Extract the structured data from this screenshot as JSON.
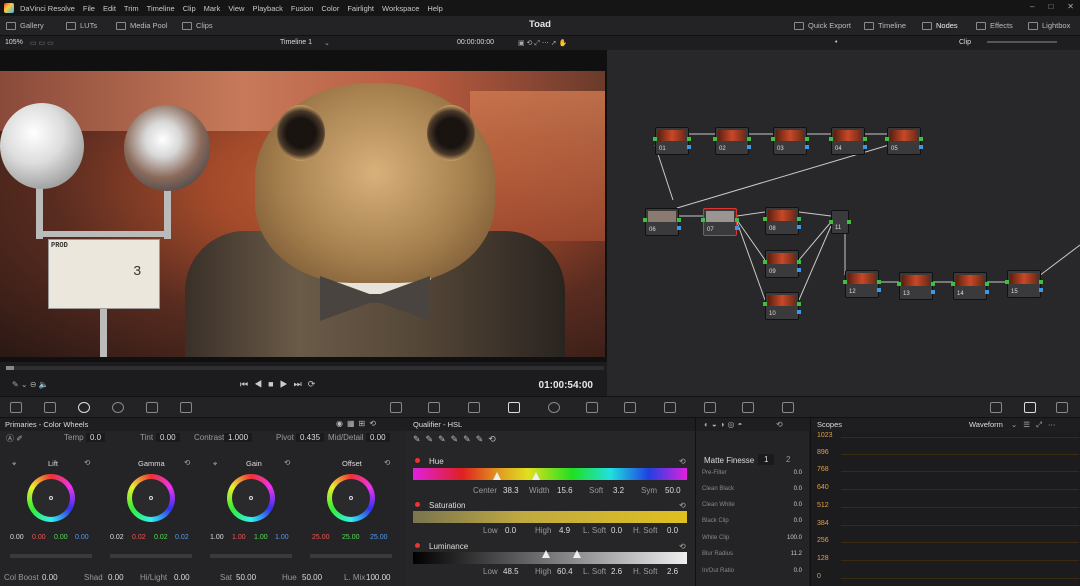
{
  "menubar": {
    "items": [
      "DaVinci Resolve",
      "File",
      "Edit",
      "Trim",
      "Timeline",
      "Clip",
      "Mark",
      "View",
      "Playback",
      "Fusion",
      "Color",
      "Fairlight",
      "Workspace",
      "Help"
    ]
  },
  "toolbar": {
    "gallery": "Gallery",
    "luts": "LUTs",
    "media_pool": "Media Pool",
    "clips": "Clips",
    "project": "Toad",
    "quick_export": "Quick Export",
    "timeline": "Timeline",
    "nodes": "Nodes",
    "effects": "Effects",
    "lightbox": "Lightbox"
  },
  "viewer": {
    "zoom": "105%",
    "timeline": "Timeline 1",
    "timecode_top": "00:00:00:00",
    "timecode": "01:00:54:00",
    "slate_text": "PROD",
    "slate_scene": "3"
  },
  "nodegraph": {
    "mode": "Clip",
    "nodes": [
      "01",
      "02",
      "03",
      "04",
      "05",
      "06",
      "07",
      "08",
      "09",
      "10",
      "11",
      "12",
      "13",
      "14",
      "15"
    ]
  },
  "primaries": {
    "title": "Primaries - Color Wheels",
    "temp_label": "Temp",
    "temp": "0.0",
    "tint_label": "Tint",
    "tint": "0.00",
    "contrast_label": "Contrast",
    "contrast": "1.000",
    "pivot_label": "Pivot",
    "pivot": "0.435",
    "middetail_label": "Mid/Detail",
    "middetail": "0.00",
    "wheels": [
      {
        "name": "Lift",
        "vals": [
          "0.00",
          "0.00",
          "0.00",
          "0.00"
        ]
      },
      {
        "name": "Gamma",
        "vals": [
          "0.02",
          "0.02",
          "0.02",
          "0.02"
        ]
      },
      {
        "name": "Gain",
        "vals": [
          "1.00",
          "1.00",
          "1.00",
          "1.00"
        ]
      },
      {
        "name": "Offset",
        "vals": [
          "25.00",
          "25.00",
          "25.00"
        ]
      }
    ],
    "colboost_label": "Col Boost",
    "colboost": "0.00",
    "shad_label": "Shad",
    "shad": "0.00",
    "hilight_label": "Hi/Light",
    "hilight": "0.00",
    "sat_label": "Sat",
    "sat": "50.00",
    "hue_label": "Hue",
    "hue": "50.00",
    "lmix_label": "L. Mix",
    "lmix": "100.00"
  },
  "qualifier": {
    "title": "Qualifier - HSL",
    "hue_label": "Hue",
    "center_label": "Center",
    "center": "38.3",
    "width_label": "Width",
    "width": "15.6",
    "soft_label": "Soft",
    "soft": "3.2",
    "sym_label": "Sym",
    "sym": "50.0",
    "sat_label": "Saturation",
    "low_label": "Low",
    "low": "0.0",
    "high_label": "High",
    "high": "4.9",
    "lsoft_label": "L. Soft",
    "lsoft": "0.0",
    "hsoft_label": "H. Soft",
    "hsoft": "0.0",
    "lum_label": "Luminance",
    "lum_low": "48.5",
    "lum_high": "60.4",
    "lum_lsoft": "2.6",
    "lum_hsoft": "2.6"
  },
  "matte": {
    "title": "Matte Finesse",
    "tab1": "1",
    "tab2": "2",
    "rows": [
      {
        "label": "Pre-Filter",
        "value": "0.0"
      },
      {
        "label": "Clean Black",
        "value": "0.0"
      },
      {
        "label": "Clean White",
        "value": "0.0"
      },
      {
        "label": "Black Clip",
        "value": "0.0"
      },
      {
        "label": "White Clip",
        "value": "100.0"
      },
      {
        "label": "Blur Radius",
        "value": "11.2"
      },
      {
        "label": "In/Out Ratio",
        "value": "0.0"
      }
    ]
  },
  "scopes": {
    "title": "Scopes",
    "mode": "Waveform",
    "ticks": [
      "1023",
      "896",
      "768",
      "640",
      "512",
      "384",
      "256",
      "128",
      "0"
    ]
  },
  "colors": {
    "accent": "#3a9ae8",
    "node_link": "#3fbf3f",
    "scope_tick": "#e0a040"
  }
}
